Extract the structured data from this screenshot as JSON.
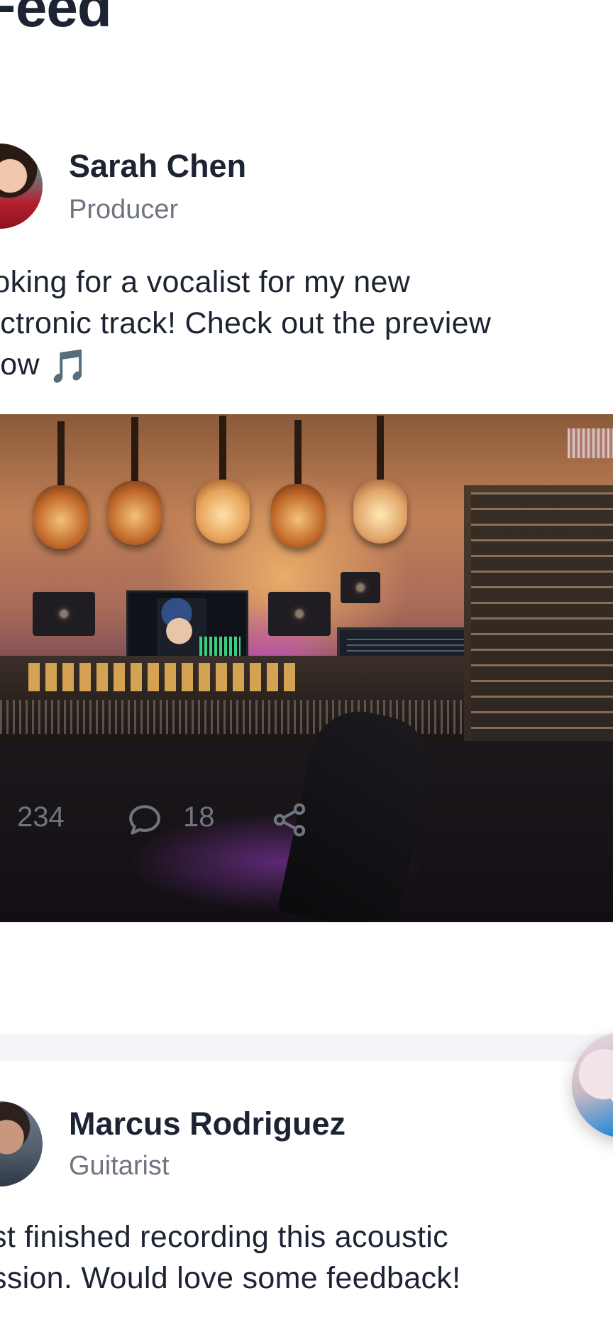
{
  "header": {
    "title": "Feed"
  },
  "posts": [
    {
      "author": "Sarah Chen",
      "role": "Producer",
      "text_lines": [
        "Looking for a vocalist for my new",
        "electronic track! Check out the preview",
        "below"
      ],
      "emoji": "🎵",
      "image_alt": "recording-studio-photo",
      "likes": "234",
      "comments": "18"
    },
    {
      "author": "Marcus Rodriguez",
      "role": "Guitarist",
      "text_lines": [
        "Just finished recording this acoustic",
        "session. Would love some feedback!"
      ]
    }
  ],
  "icons": {
    "comment": "comment-icon",
    "share": "share-icon"
  },
  "colors": {
    "text_primary": "#1c2333",
    "text_secondary": "#6f7580",
    "accent_note": "#1e9be0"
  }
}
